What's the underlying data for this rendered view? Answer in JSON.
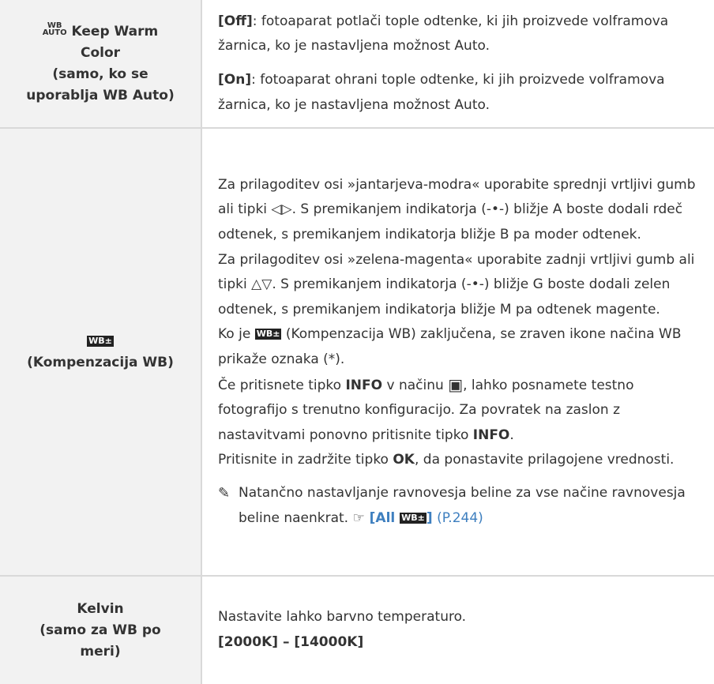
{
  "rows": [
    {
      "left": {
        "icon_top": "WB",
        "icon_bottom": "AUTO",
        "title": "Keep Warm",
        "lines": [
          "Color",
          "(samo, ko se",
          "uporablja WB Auto)"
        ]
      },
      "right": {
        "p1_bold": "[Off]",
        "p1_text": ": fotoaparat potlači tople odtenke, ki jih proizvede volframova žarnica, ko je nastavljena možnost Auto.",
        "p2_bold": "[On]",
        "p2_text": ": fotoaparat ohrani tople odtenke, ki jih proizvede volframova žarnica, ko je nastavljena možnost Auto."
      }
    },
    {
      "left": {
        "icon": "WB±",
        "label": "(Kompenzacija WB)"
      },
      "right": {
        "a1": "Za prilagoditev osi »jantarjeva-modra« uporabite sprednji vrtljivi gumb ali tipki ",
        "a_arrows": "◁▷",
        "a2": ". S premikanjem indikatorja (",
        "a_ind": "-•-",
        "a3": ") bližje A boste dodali rdeč odtenek, s premikanjem indikatorja bližje B pa moder odtenek.",
        "b1": "Za prilagoditev osi »zelena-magenta« uporabite zadnji vrtljivi gumb ali tipki ",
        "b_arrows": "△▽",
        "b2": ". S premikanjem indikatorja (",
        "b_ind": "-•-",
        "b3": ") bližje G boste dodali zelen odtenek, s premikanjem indikatorja bližje M pa odtenek magente.",
        "c1": "Ko je ",
        "c_icon": "WB±",
        "c2": " (Kompenzacija WB) zaključena, se zraven ikone načina WB prikaže oznaka (*).",
        "d1": "Če pritisnete tipko ",
        "d_info": "INFO",
        "d2": " v načinu ",
        "d_cam": "▣",
        "d3": ", lahko posnamete testno fotografijo s trenutno konfiguracijo. Za povratek na zaslon z nastavitvami ponovno pritisnite tipko ",
        "d_info2": "INFO",
        "d4": ".",
        "e1": "Pritisnite in zadržite tipko ",
        "e_ok": "OK",
        "e2": ", da ponastavite prilagojene vrednosti.",
        "note_icon": "✎",
        "note_text": "Natančno nastavljanje ravnovesja beline za vse načine ravnovesja beline naenkrat. ",
        "note_ref_icon": "☞",
        "note_ref_bold": " [All ",
        "note_ref_icon2": "WB±",
        "note_ref_bold2": "]",
        "note_ref_page": " (P.244)"
      }
    },
    {
      "left": {
        "lines": [
          "Kelvin",
          "(samo za WB po",
          "meri)"
        ]
      },
      "right": {
        "text": "Nastavite lahko barvno temperaturo.",
        "range_a": "[2000K]",
        "range_sep": " – ",
        "range_b": "[14000K]"
      }
    }
  ]
}
